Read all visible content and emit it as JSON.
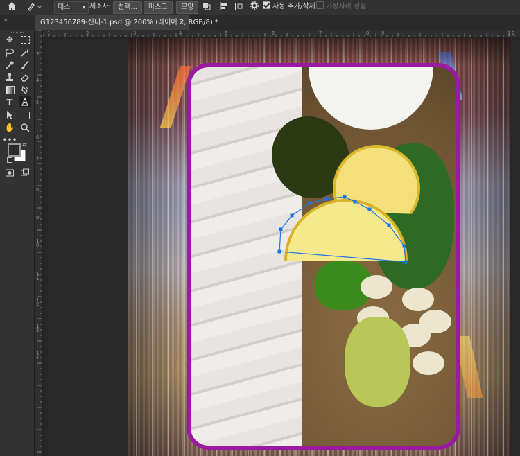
{
  "options_bar": {
    "mode_dropdown": "패스",
    "construct_label": "제조사:",
    "buttons": [
      "선택...",
      "마스크",
      "모양"
    ],
    "auto_add_delete": "자동 추가/삭제",
    "align_edges": "가장자리 정렬"
  },
  "document_tab": {
    "title": "G123456789-신디-1.psd @ 200% (레이어 2, RGB/8) *",
    "close": "×"
  },
  "ruler": {
    "top_labels": [
      "1",
      "2",
      "3",
      "4",
      "5",
      "6",
      "7",
      "8",
      "9",
      "1",
      "0"
    ],
    "left_labels": [
      "3",
      "4",
      "5",
      "6",
      "7",
      "8",
      "9",
      "1",
      "0",
      "1",
      "1",
      "1",
      "2",
      "1",
      "3",
      "1",
      "4"
    ]
  },
  "colors": {
    "frame": "#9a1aa2",
    "path": "#1a73e8"
  },
  "tools": [
    "move",
    "marquee",
    "lasso",
    "magic-wand",
    "eyedropper",
    "brush",
    "stamp",
    "eraser",
    "gradient",
    "smudge",
    "text",
    "pen",
    "path-select",
    "shape",
    "hand",
    "zoom",
    "more",
    "colors",
    "quick-mask",
    "screen-mode"
  ]
}
